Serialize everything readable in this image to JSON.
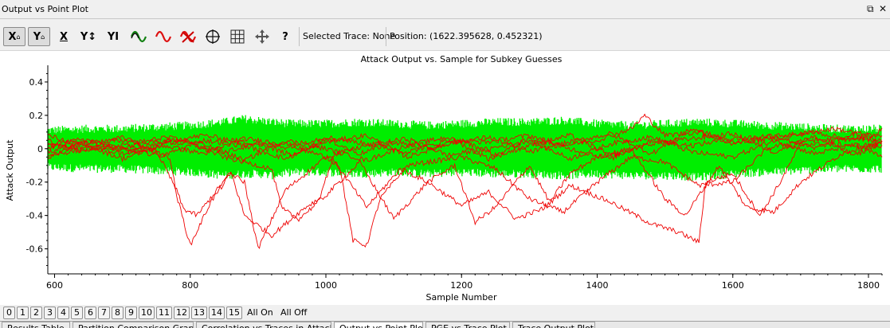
{
  "window": {
    "title": "Output vs Point Plot"
  },
  "toolbar": {
    "buttons": [
      {
        "name": "x-lock-button",
        "label": "X",
        "pressed": true
      },
      {
        "name": "y-lock-button",
        "label": "Y",
        "pressed": true
      },
      {
        "name": "x-select-button",
        "label": "X",
        "pressed": false
      },
      {
        "name": "y-autoscale-button",
        "label": "Y↕",
        "pressed": false
      },
      {
        "name": "y-cursor-button",
        "label": "YI",
        "pressed": false
      },
      {
        "name": "wave-green-button",
        "label": "",
        "pressed": false
      },
      {
        "name": "wave-red-button",
        "label": "",
        "pressed": false
      },
      {
        "name": "wave-clear-button",
        "label": "",
        "pressed": false
      },
      {
        "name": "crosshair-button",
        "label": "",
        "pressed": false
      },
      {
        "name": "grid-button",
        "label": "",
        "pressed": false
      },
      {
        "name": "pan-button",
        "label": "",
        "pressed": false
      },
      {
        "name": "help-button",
        "label": "?",
        "pressed": false
      }
    ],
    "selected_trace": "Selected Trace: None",
    "position": "Position: (1622.395628, 0.452321)"
  },
  "chart_data": {
    "type": "line",
    "title": "Attack Output vs. Sample for Subkey Guesses",
    "xlabel": "Sample Number",
    "ylabel": "Attack Output",
    "xlim": [
      590,
      1820
    ],
    "ylim": [
      -0.75,
      0.5
    ],
    "xticks": [
      600,
      800,
      1000,
      1200,
      1400,
      1600,
      1800
    ],
    "yticks": [
      0.4,
      0.2,
      0,
      -0.2,
      -0.4,
      -0.6
    ],
    "ytick_labels": [
      "0.4",
      "0.2",
      "0",
      "-0.2",
      "-0.4",
      "-0.6"
    ],
    "series": [
      {
        "color": "#00ee00",
        "kind": "envelope",
        "x": [
          590,
          650,
          700,
          750,
          800,
          850,
          880,
          900,
          920,
          950,
          1000,
          1050,
          1100,
          1150,
          1200,
          1250,
          1300,
          1350,
          1400,
          1450,
          1500,
          1550,
          1600,
          1650,
          1700,
          1750,
          1800,
          1820
        ],
        "upper": [
          0.11,
          0.12,
          0.12,
          0.13,
          0.14,
          0.16,
          0.18,
          0.17,
          0.16,
          0.15,
          0.15,
          0.16,
          0.15,
          0.14,
          0.15,
          0.16,
          0.16,
          0.17,
          0.15,
          0.14,
          0.15,
          0.16,
          0.15,
          0.14,
          0.13,
          0.12,
          0.12,
          0.12
        ],
        "lower": [
          -0.11,
          -0.12,
          -0.12,
          -0.13,
          -0.14,
          -0.16,
          -0.15,
          -0.15,
          -0.16,
          -0.14,
          -0.14,
          -0.15,
          -0.14,
          -0.15,
          -0.14,
          -0.15,
          -0.15,
          -0.16,
          -0.15,
          -0.16,
          -0.16,
          -0.17,
          -0.15,
          -0.14,
          -0.13,
          -0.12,
          -0.12,
          -0.12
        ]
      },
      {
        "color": "#ee0000",
        "x": [
          590,
          700,
          770,
          780,
          800,
          830,
          860,
          880,
          900,
          940,
          1000,
          1020,
          1040,
          1060,
          1080,
          1120,
          1200,
          1250,
          1300,
          1350,
          1400,
          1450,
          1500,
          1550,
          1600,
          1650,
          1700,
          1800,
          1820
        ],
        "y": [
          0.02,
          0.0,
          -0.05,
          -0.28,
          -0.58,
          -0.32,
          -0.15,
          -0.2,
          -0.6,
          -0.25,
          -0.05,
          -0.1,
          -0.55,
          -0.58,
          -0.3,
          -0.1,
          -0.05,
          -0.12,
          -0.3,
          -0.38,
          -0.2,
          -0.05,
          -0.08,
          -0.22,
          -0.2,
          0.0,
          0.05,
          0.06,
          0.05
        ]
      },
      {
        "color": "#ee0000",
        "x": [
          590,
          650,
          700,
          750,
          780,
          790,
          810,
          860,
          880,
          920,
          970,
          990,
          1010,
          1060,
          1110,
          1150,
          1200,
          1240,
          1280,
          1320,
          1360,
          1420,
          1480,
          1520,
          1550,
          1560,
          1600,
          1640,
          1670,
          1700,
          1800,
          1820
        ],
        "y": [
          -0.04,
          0.0,
          0.02,
          -0.01,
          -0.25,
          -0.36,
          -0.4,
          -0.14,
          -0.4,
          -0.52,
          -0.35,
          -0.3,
          -0.06,
          -0.35,
          -0.12,
          -0.2,
          -0.34,
          -0.26,
          -0.42,
          -0.36,
          -0.22,
          -0.32,
          -0.45,
          -0.5,
          -0.56,
          -0.2,
          -0.15,
          -0.4,
          -0.2,
          0.03,
          0.02,
          0.01
        ]
      },
      {
        "color": "#ee0000",
        "x": [
          590,
          700,
          800,
          850,
          920,
          935,
          960,
          1000,
          1050,
          1100,
          1150,
          1190,
          1220,
          1250,
          1300,
          1330,
          1360,
          1400,
          1450,
          1500,
          1530,
          1580,
          1620,
          1660,
          1700,
          1760,
          1800,
          1820
        ],
        "y": [
          0.03,
          0.05,
          0.03,
          -0.05,
          -0.12,
          -0.36,
          -0.42,
          -0.28,
          -0.08,
          -0.42,
          -0.2,
          -0.1,
          -0.44,
          -0.35,
          -0.1,
          -0.32,
          -0.15,
          -0.05,
          0.0,
          -0.3,
          -0.4,
          -0.1,
          -0.35,
          -0.38,
          -0.2,
          -0.03,
          0.02,
          0.03
        ]
      },
      {
        "color": "#ee0000",
        "x": [
          590,
          650,
          720,
          780,
          850,
          900,
          950,
          1000,
          1050,
          1100,
          1150,
          1200,
          1250,
          1300,
          1350,
          1400,
          1450,
          1470,
          1500,
          1550,
          1600,
          1650,
          1700,
          1750,
          1800,
          1820
        ],
        "y": [
          -0.02,
          0.04,
          -0.03,
          0.05,
          -0.02,
          0.03,
          -0.04,
          0.06,
          -0.03,
          0.04,
          0.0,
          0.05,
          -0.04,
          0.06,
          0.02,
          0.05,
          0.12,
          0.2,
          0.08,
          0.1,
          0.03,
          0.07,
          0.09,
          0.12,
          0.08,
          0.07
        ]
      },
      {
        "color": "#ee0000",
        "x": [
          590,
          640,
          700,
          760,
          820,
          880,
          940,
          1000,
          1060,
          1120,
          1180,
          1240,
          1300,
          1360,
          1420,
          1480,
          1540,
          1600,
          1660,
          1720,
          1780,
          1820
        ],
        "y": [
          0.05,
          -0.02,
          0.07,
          -0.04,
          0.05,
          0.02,
          -0.06,
          0.04,
          0.08,
          -0.05,
          0.03,
          0.07,
          -0.02,
          0.04,
          0.09,
          -0.03,
          0.12,
          0.04,
          0.06,
          0.1,
          0.05,
          0.11
        ]
      },
      {
        "color": "#ee0000",
        "x": [
          590,
          640,
          700,
          760,
          820,
          880,
          940,
          1000,
          1060,
          1120,
          1180,
          1240,
          1300,
          1360,
          1420,
          1480,
          1540,
          1600,
          1660,
          1720,
          1780,
          1820
        ],
        "y": [
          -0.05,
          0.03,
          -0.06,
          0.02,
          -0.03,
          0.06,
          0.03,
          -0.05,
          0.02,
          0.06,
          -0.04,
          0.0,
          0.05,
          -0.06,
          0.03,
          0.07,
          -0.02,
          -0.05,
          0.05,
          -0.03,
          0.02,
          -0.05
        ]
      },
      {
        "color": "#ee0000",
        "x": [
          590,
          640,
          700,
          760,
          820,
          880,
          940,
          1000,
          1060,
          1120,
          1180,
          1240,
          1300,
          1360,
          1420,
          1480,
          1540,
          1600,
          1660,
          1720,
          1780,
          1820
        ],
        "y": [
          0.0,
          0.06,
          0.0,
          0.07,
          0.03,
          -0.07,
          0.05,
          0.0,
          -0.07,
          0.02,
          0.07,
          -0.06,
          0.02,
          0.08,
          -0.04,
          0.03,
          0.06,
          0.09,
          -0.02,
          0.07,
          -0.04,
          0.04
        ]
      },
      {
        "color": "#ee0000",
        "x": [
          590,
          640,
          700,
          760,
          820,
          880,
          940,
          1000,
          1060,
          1120,
          1180,
          1240,
          1300,
          1360,
          1420,
          1480,
          1540,
          1600,
          1660,
          1720,
          1780,
          1820
        ],
        "y": [
          0.08,
          0.02,
          -0.03,
          0.04,
          0.08,
          0.04,
          0.01,
          0.07,
          0.03,
          -0.02,
          0.05,
          0.04,
          0.08,
          0.0,
          -0.06,
          0.05,
          0.02,
          0.06,
          0.08,
          0.0,
          0.09,
          0.02
        ]
      }
    ]
  },
  "channels": {
    "items": [
      "0",
      "1",
      "2",
      "3",
      "4",
      "5",
      "6",
      "7",
      "8",
      "9",
      "10",
      "11",
      "12",
      "13",
      "14",
      "15"
    ],
    "all_on": "All On",
    "all_off": "All Off"
  },
  "tabs": [
    "Results Table",
    "Partition Comparison Graph",
    "Correlation vs Traces in Attack",
    "Output vs Point Plot",
    "PGE vs Trace Plot",
    "Trace Output Plot"
  ]
}
